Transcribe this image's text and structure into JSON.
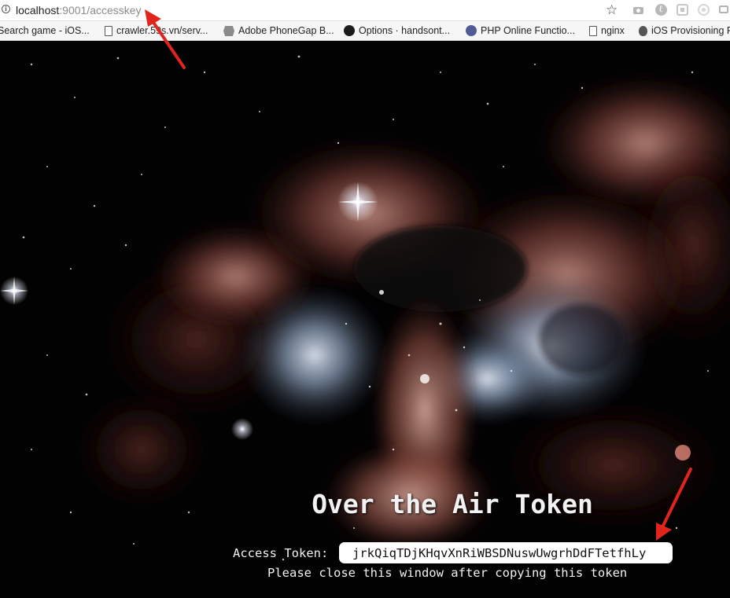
{
  "browser": {
    "url_host": "localhost",
    "url_rest": ":9001/accesskey",
    "bookmarks": [
      {
        "label": "Search game - iOS...",
        "icon": "folder-icon"
      },
      {
        "label": "crawler.59s.vn/serv...",
        "icon": "page-icon"
      },
      {
        "label": "Adobe PhoneGap B...",
        "icon": "gear-badge-icon"
      },
      {
        "label": "Options · handsont...",
        "icon": "github-icon"
      },
      {
        "label": "PHP Online Functio...",
        "icon": "php-icon"
      },
      {
        "label": "nginx",
        "icon": "page-icon"
      },
      {
        "label": "iOS Provisioning P",
        "icon": "apple-icon"
      }
    ]
  },
  "page": {
    "title": "Over the Air Token",
    "token_label": "Access Token:",
    "token_value": "jrkQiqTDjKHqvXnRiWBSDNuswUwgrhDdFTetfhLy",
    "instruction": "Please close this window after copying this token"
  },
  "colors": {
    "annotation_arrow": "#e0261c",
    "page_text": "#f2f2f2",
    "background": "#000000"
  }
}
